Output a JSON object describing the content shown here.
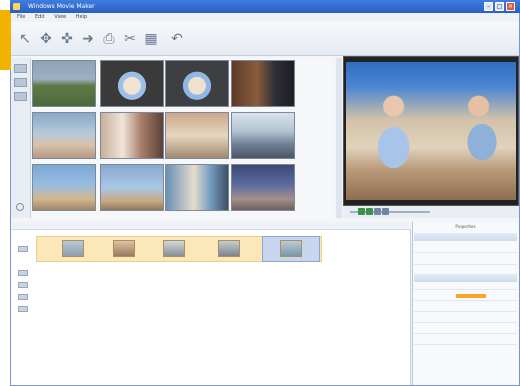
{
  "window": {
    "title": "Windows Movie Maker"
  },
  "menu": [
    "File",
    "Edit",
    "View",
    "Help"
  ],
  "toolbar_icons": [
    "cursor-icon",
    "capture-icon",
    "effects-icon",
    "arrow-icon",
    "share-icon",
    "cut-icon",
    "storyboard-icon",
    "undo-icon"
  ],
  "collection": {
    "thumbnails": [
      "thumb-0",
      "thumb-1",
      "thumb-2",
      "thumb-3",
      "thumb-4",
      "thumb-5",
      "thumb-6",
      "thumb-7",
      "thumb-8",
      "thumb-9",
      "thumb-10",
      "thumb-11"
    ]
  },
  "storyboard": {
    "clips": 5
  },
  "props": {
    "title": "Properties"
  },
  "colors": {
    "accent": "#f2b300",
    "titlebar": "#2a5fc0",
    "clip_row": "#fbe7b8",
    "selection": "#c7d6ec",
    "highlight": "#f6a623"
  }
}
